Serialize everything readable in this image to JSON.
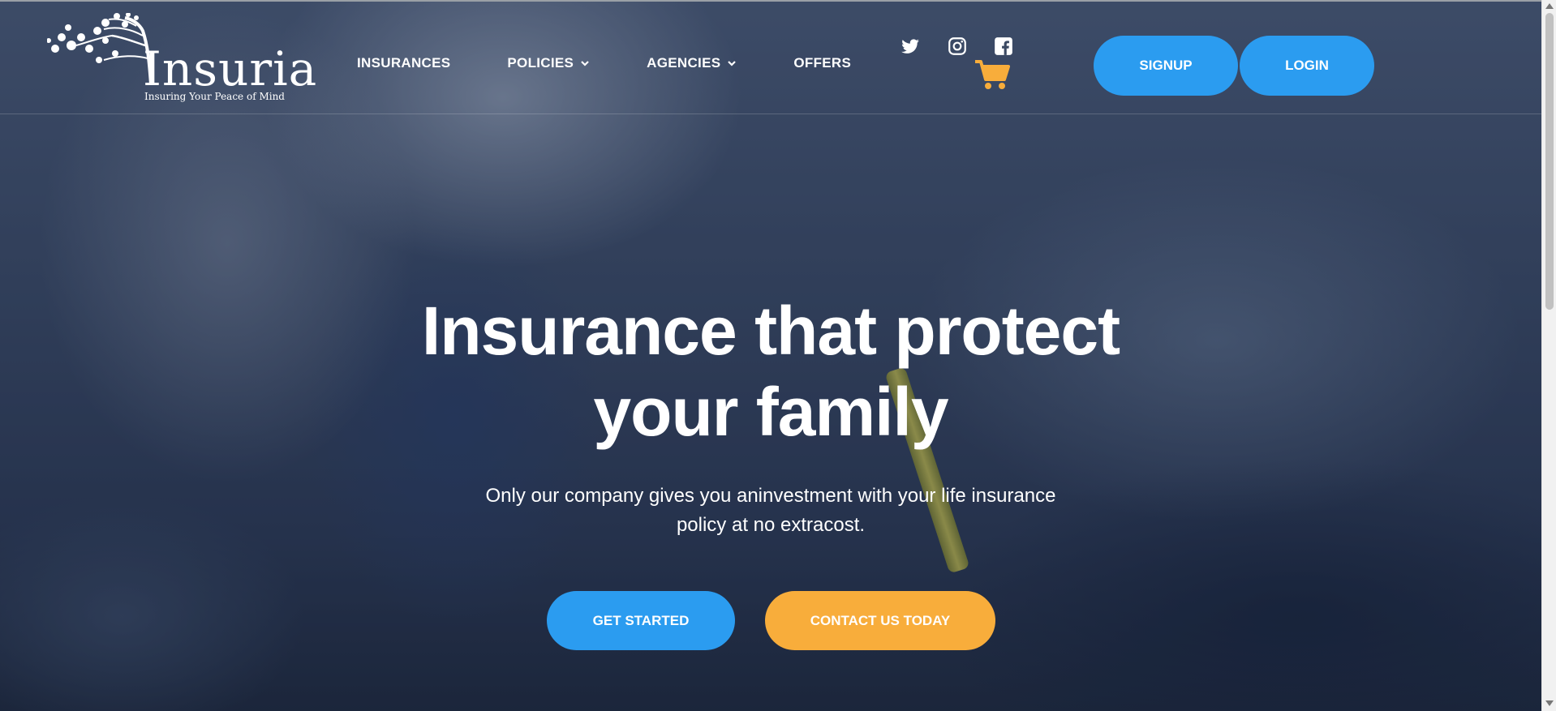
{
  "brand": {
    "name": "Insuria",
    "tagline": "Insuring Your Peace of Mind"
  },
  "nav": {
    "items": [
      {
        "label": "INSURANCES",
        "icon": null
      },
      {
        "label": "POLICIES",
        "icon": "chevron-down-icon"
      },
      {
        "label": "AGENCIES",
        "icon": "chevron-down-icon"
      },
      {
        "label": "OFFERS",
        "icon": null
      }
    ]
  },
  "social": {
    "icons": [
      "twitter-icon",
      "instagram-icon",
      "facebook-icon"
    ]
  },
  "cart": {
    "icon": "shopping-cart-icon"
  },
  "auth": {
    "signup_label": "SIGNUP",
    "login_label": "LOGIN"
  },
  "hero": {
    "title_line1": "Insurance that protect",
    "title_line2": "your family",
    "subtitle_line1": "Only our company gives you aninvestment with your life insurance",
    "subtitle_line2": "policy at no extracost.",
    "primary_cta": "GET STARTED",
    "secondary_cta": "CONTACT US TODAY"
  },
  "colors": {
    "primary_blue": "#2b9cf0",
    "accent_orange": "#f8ad3b",
    "cart_orange": "#f8ad3b",
    "text_white": "#ffffff"
  }
}
